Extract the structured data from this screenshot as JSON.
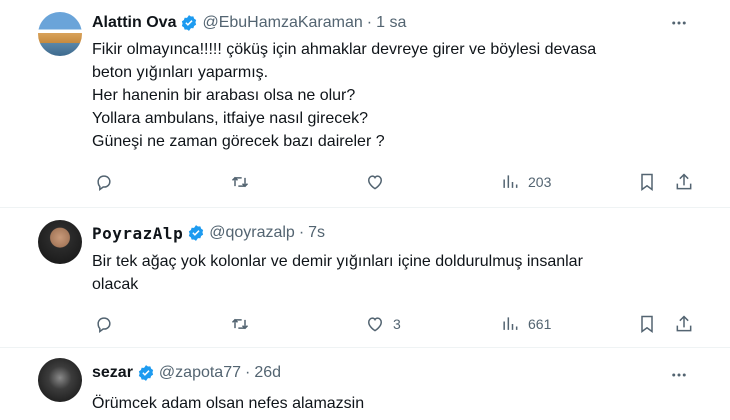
{
  "tweets": [
    {
      "name": "Alattin Ova",
      "handle": "@EbuHamzaKaraman",
      "separator": "·",
      "time": "1 sa",
      "lines": [
        "Fikir olmayınca!!!!! çöküş için ahmaklar devreye girer ve böylesi devasa",
        "beton yığınları yaparmış.",
        "Her hanenin bir arabası olsa ne olur?",
        "Yollara ambulans, itfaiye nasıl girecek?",
        "Güneşi ne zaman görecek bazı daireler ?"
      ],
      "replies": "",
      "retweets": "",
      "likes": "",
      "views": "203"
    },
    {
      "name": "PoyrazAlp",
      "handle": "@qoyrazalp",
      "separator": "·",
      "time": "7s",
      "lines": [
        "Bir tek ağaç yok kolonlar ve demir yığınları içine doldurulmuş insanlar",
        "olacak"
      ],
      "replies": "",
      "retweets": "",
      "likes": "3",
      "views": "661"
    },
    {
      "name": "sezar",
      "handle": "@zapota77",
      "separator": "·",
      "time": "26d",
      "lines": [
        "Örümcek adam olsan nefes alamazsin"
      ]
    }
  ],
  "colors": {
    "verified": "#1d9bf0",
    "secondary_text": "#536471",
    "primary_text": "#0f1419",
    "divider": "#eff3f4"
  },
  "icons": [
    "more-icon",
    "reply-icon",
    "retweet-icon",
    "like-icon",
    "views-icon",
    "bookmark-icon",
    "share-icon",
    "verified-badge-icon"
  ]
}
